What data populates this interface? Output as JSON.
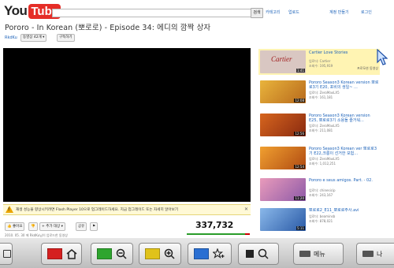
{
  "header": {
    "logo_you": "You",
    "logo_tube": "Tube",
    "search_value": "",
    "search_button": "검색",
    "links": [
      "카테고리",
      "업로드",
      "계정 만들기",
      "로그인"
    ]
  },
  "video": {
    "title": "Pororo - In Korean (뽀로로) - Episode 34: 에디의 깜짝 상자",
    "channel": "RkdKu",
    "video_count": "동영상 42개",
    "subscribe": "구독하기"
  },
  "flash_warning": {
    "text": "재생 성능을 향상시키려면 Flash Player 10으로 업그레이드하세요. 지금 업그레이드 또는 자세히 알아보기",
    "close": "✕"
  },
  "actions": {
    "like": "좋아요",
    "add": "+ 추가 대상",
    "share": "공유",
    "flag": "⚑"
  },
  "stats": {
    "views": "337,732",
    "like_fraction": 0.93,
    "upload_info": "2010. 05. 30 에 RkdKu님이 업로드한 동영상"
  },
  "related": [
    {
      "title": "Cartier Love Stories",
      "channel": "업로더: Cartier",
      "views": "조회수: 195,919",
      "duration": "1:41",
      "tag": "프로모션 동영상",
      "thumb": "#d9c7c2"
    },
    {
      "title": "Pororo Season3 Korean version 뽀로로3기 E20, 포비의 생일~ ...",
      "channel": "업로더: ZeroMaxLX5",
      "views": "조회수: 161,181",
      "duration": "12:08",
      "tag": "",
      "thumb": "#d99a2a"
    },
    {
      "title": "Pororo Season3 Korean version E25, 뽀로로3기 소용돌 즐거워...",
      "channel": "업로더: ZeroMaxLX5",
      "views": "조회수: 211,081",
      "duration": "12:56",
      "tag": "",
      "thumb": "#b84a18"
    },
    {
      "title": "Pororo Season3 Korean ver 뽀로로3기 E22,크롱이 선거한 모험...",
      "channel": "업로더: ZeroMaxLX5",
      "views": "조회수: 1,012,251",
      "duration": "12:54",
      "tag": "",
      "thumb": "#c56a1a"
    },
    {
      "title": "Pororo e seus amigos. Part. - 02.",
      "channel": "업로더: chinesicip",
      "views": "조회수: 243,167",
      "duration": "11:20",
      "tag": "",
      "thumb": "#d77fa2"
    },
    {
      "title": "뽀로로2_E11_뽀로로주사.avi",
      "channel": "업로더: beaminsb",
      "views": "조회수: 878,021",
      "duration": "5:11",
      "tag": "",
      "thumb": "#5a86c8"
    }
  ],
  "remote": {
    "keys": [
      {
        "color": "#d52020",
        "glyph": "home-icon"
      },
      {
        "color": "#2ea52e",
        "glyph": "zoom-out-icon"
      },
      {
        "color": "#e0c21a",
        "glyph": "zoom-in-icon"
      },
      {
        "color": "#2a6fd2",
        "glyph": "star-add-icon"
      },
      {
        "color": "",
        "glyph": "stop-search-icon"
      }
    ],
    "menu_label": "메뉴",
    "next_label": "나"
  }
}
